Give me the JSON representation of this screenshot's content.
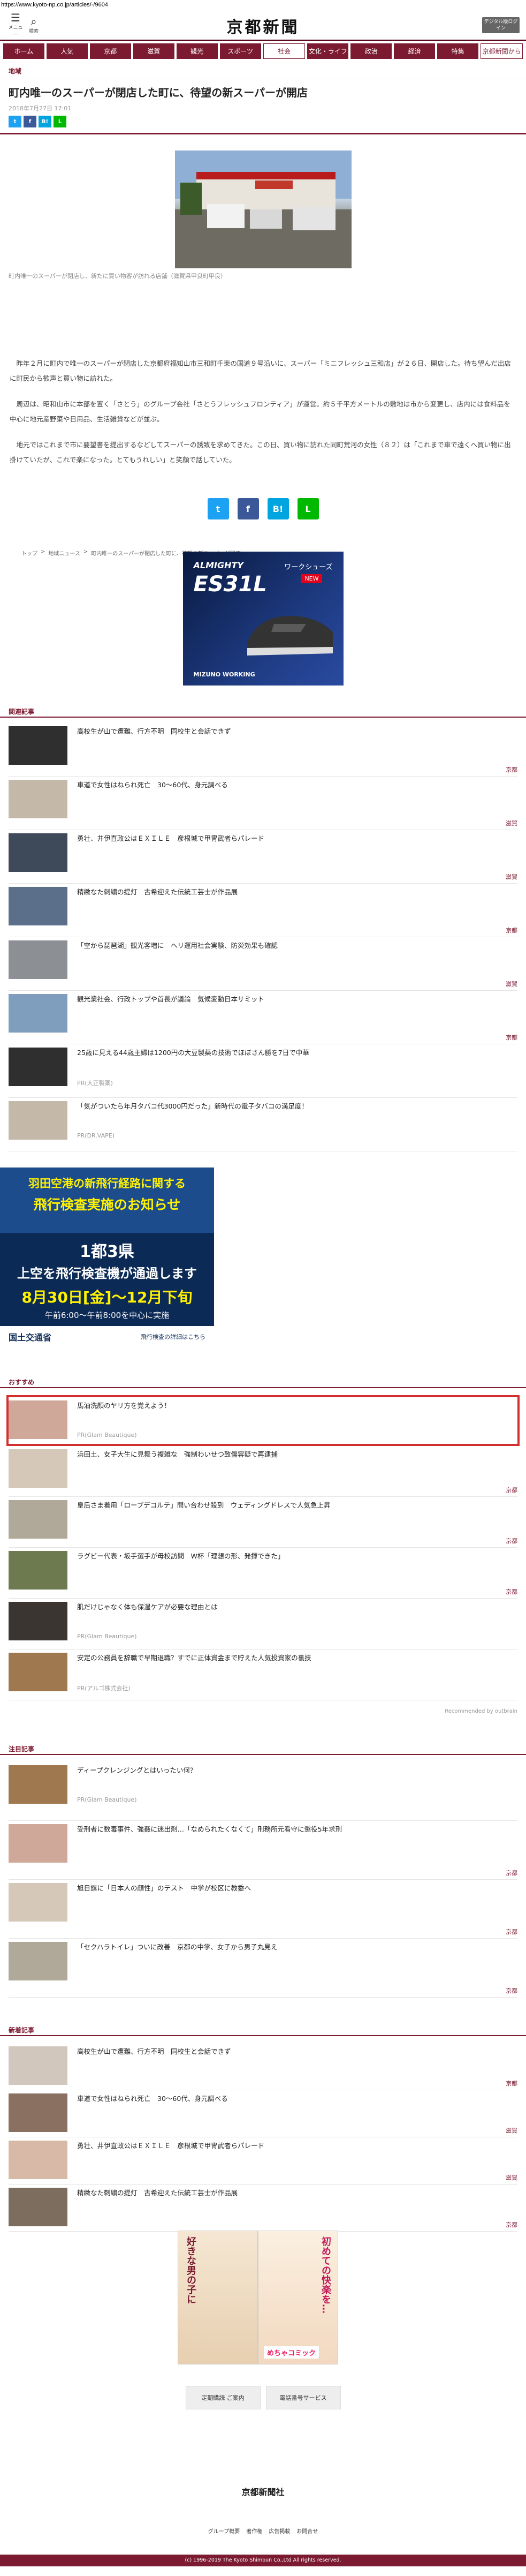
{
  "url": "https://www.kyoto-np.co.jp/articles/-/9604",
  "header": {
    "menu_label": "メニュー",
    "search_label": "検索",
    "logo": "京都新聞",
    "login_label": "デジタル版ログイン"
  },
  "nav": [
    {
      "label": "ホーム"
    },
    {
      "label": "人気"
    },
    {
      "label": "京都"
    },
    {
      "label": "滋賀"
    },
    {
      "label": "観光"
    },
    {
      "label": "スポーツ"
    },
    {
      "label": "社会"
    },
    {
      "label": "文化・ライフ"
    },
    {
      "label": "政治"
    },
    {
      "label": "経済"
    },
    {
      "label": "特集"
    },
    {
      "label": "京都新聞から"
    }
  ],
  "article": {
    "category": "地域",
    "title": "町内唯一のスーパーが閉店した町に、待望の新スーパーが開店",
    "datetime": "2018年7月27日 17:01",
    "caption": "町内唯一のスーパーが閉店し、新たに買い物客が訪れる店舗（滋賀県甲良町甲良）",
    "paragraphs": [
      "昨年２月に町内で唯一のスーパーが閉店した京都府福知山市三和町千束の国道９号沿いに、スーパー「ミニフレッシュ三和店」が２６日、開店した。待ち望んだ出店に町民から歓声と買い物に訪れた。",
      "周辺は、昭和山市に本部を置く「さとう」のグループ会社「さとうフレッシュフロンティア」が運営。約５千平方メートルの敷地は市から変更し、店内には食料品を中心に地元産野菜や日用品、生活雑貨などが並ぶ。",
      "地元ではこれまで市に要望書を提出するなどしてスーパーの誘致を求めてきた。この日、買い物に訪れた同町荒河の女性（８２）は「これまで車で遠くへ買い物に出掛けていたが、これで楽になった。とてもうれしい」と笑顔で話していた。"
    ],
    "share_small": [
      "t",
      "f",
      "B!",
      "L"
    ],
    "share_large": [
      "t",
      "f",
      "B!",
      "L"
    ]
  },
  "breadcrumb": [
    "トップ",
    "地域ニュース",
    "町内唯一のスーパーが閉店した町に、待望の新スーパーが開店"
  ],
  "ad_shoe": {
    "brand": "ALMIGHTY",
    "model": "ES31L",
    "tag": "ワークシューズ",
    "new": "NEW",
    "maker": "MIZUNO WORKING"
  },
  "related": {
    "title": "関連記事",
    "items": [
      {
        "title": "高校生が山で遭難、行方不明　同校生と会話できず",
        "source": "京都"
      },
      {
        "title": "車道で女性はねられ死亡　30～60代、身元調べる",
        "source": "滋賀"
      },
      {
        "title": "勇壮、井伊直政公はＥＸＩＬＥ　彦根城で甲冑武者らパレード",
        "source": "滋賀"
      },
      {
        "title": "精緻なた刺繍の提灯　古希迎えた伝統工芸士が作品展",
        "source": "京都"
      },
      {
        "title": "「空から琵琶湖」観光客増に　ヘリ運用社会実験、防災効果も確認",
        "source": "滋賀"
      },
      {
        "title": "観光業社会、行政トップや首長が議論　気候変動日本サミット",
        "source": "京都"
      },
      {
        "title": "25歳に見える44歳主婦は1200円の大豆製薬の技術でほぼさん勝を7日で中華",
        "pr": "PR(大正製薬)"
      },
      {
        "title": "「気がついたら年月タバコ代3000円だった」新時代の電子タバコの満足度！",
        "pr": "PR(DR.VAPE)"
      }
    ]
  },
  "ad_airport": {
    "line1": "羽田空港の新飛行経路に関する",
    "line2": "飛行検査実施のお知らせ",
    "line3": "1都3県",
    "line4": "上空を飛行検査機が通過します",
    "line5": "8月30日[金]〜12月下旬",
    "line6": "午前6:00〜午前8:00を中心に実施",
    "org": "国土交通省",
    "link": "飛行検査の詳細はこちら"
  },
  "recommended": {
    "title": "おすすめ",
    "items": [
      {
        "title": "馬油洗顔のヤリ方を覚えよう！",
        "pr": "PR(Glam Beautique)",
        "highlighted": true
      },
      {
        "title": "浜田土、女子大生に見舞う複雑な　強制わいせつ致傷容疑で再逮捕",
        "source": "京都"
      },
      {
        "title": "皇后さま着用「ローブデコルテ」問い合わせ殺到　ウェディングドレスで人気急上昇",
        "source": "京都"
      },
      {
        "title": "ラグビー代表・坂手選手が母校訪問　W杯「理想の形、発揮できた」",
        "source": "京都"
      },
      {
        "title": "肌だけじゃなく体も保湿ケアが必要な理由とは",
        "pr": "PR(Glam Beautique)"
      },
      {
        "title": "安定の公務員を辞職で早期退職？すでに正体資金まで貯えた人気投資家の裏技",
        "pr": "PR(アルゴ株式会社)"
      }
    ],
    "recommended_by": "Recommended by outbrain"
  },
  "featured": {
    "title": "注目記事",
    "items": [
      {
        "title": "ディープクレンジングとはいったい何？",
        "pr": "PR(Glam Beautique)"
      },
      {
        "title": "受刑者に数毒事件、強姦に迷出剤…「なめられたくなくて」刑務所元看守に懲役5年求刑",
        "source": "京都"
      },
      {
        "title": "旭日旗に「日本人の顔性」のテスト　中学が校区に教委へ",
        "source": "京都"
      },
      {
        "title": "「セクハラトイレ」ついに改善　京都の中学、女子から男子丸見え",
        "source": "京都"
      }
    ]
  },
  "latest": {
    "title": "新着記事",
    "items": [
      {
        "title": "高校生が山で遭難、行方不明　同校生と会話できず",
        "source": "京都"
      },
      {
        "title": "車道で女性はねられ死亡　30～60代、身元調べる",
        "source": "滋賀"
      },
      {
        "title": "勇壮、井伊直政公はＥＸＩＬＥ　彦根城で甲冑武者らパレード",
        "source": "滋賀"
      },
      {
        "title": "精緻なた刺繍の提灯　古希迎えた伝統工芸士が作品展",
        "source": "京都"
      }
    ]
  },
  "ad_manga": {
    "left": "好きな男の子に",
    "right": "初めての快楽を…",
    "tag": "めちゃコミック"
  },
  "footer": {
    "btn1": "定期購読 ご案内",
    "btn2": "電話番号サービス",
    "logo": "京都新聞社",
    "links": [
      "グループ概要",
      "著作権",
      "広告掲載",
      "お問合せ"
    ],
    "copyright": "(c) 1996-2019 The Kyoto Shimbun Co.,Ltd All rights reserved."
  },
  "colors": {
    "brand": "#7b1a30",
    "twitter": "#1da1f2",
    "facebook": "#3b5998",
    "hatena": "#00a4de",
    "line": "#00b900"
  }
}
